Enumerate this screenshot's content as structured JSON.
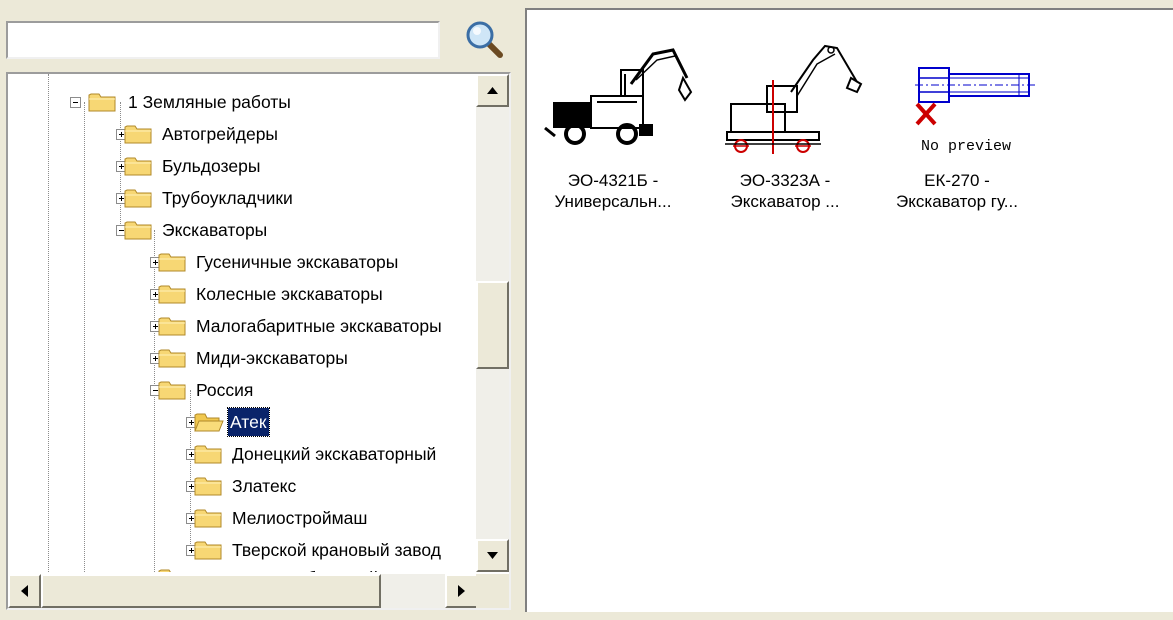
{
  "search": {
    "value": "",
    "placeholder": ""
  },
  "tree": {
    "items": [
      {
        "label": "1 Земляные работы",
        "state": "expanded"
      },
      {
        "label": "Автогрейдеры",
        "state": "collapsed"
      },
      {
        "label": "Бульдозеры",
        "state": "collapsed"
      },
      {
        "label": "Трубоукладчики",
        "state": "collapsed"
      },
      {
        "label": "Экскаваторы",
        "state": "expanded"
      },
      {
        "label": "Гусеничные экскаваторы",
        "state": "collapsed"
      },
      {
        "label": "Колесные экскаваторы",
        "state": "collapsed"
      },
      {
        "label": "Малогабаритные экскаваторы",
        "state": "collapsed"
      },
      {
        "label": "Миди-экскаваторы",
        "state": "collapsed"
      },
      {
        "label": "Россия",
        "state": "expanded"
      },
      {
        "label": "Атек",
        "state": "collapsed",
        "selected": true
      },
      {
        "label": "Донецкий экскаваторный",
        "state": "collapsed"
      },
      {
        "label": "Златекс",
        "state": "collapsed"
      },
      {
        "label": "Мелиостроймаш",
        "state": "collapsed"
      },
      {
        "label": "Тверской крановый завод",
        "state": "collapsed"
      },
      {
        "label": "Экскаваторы большой мощности",
        "state": "collapsed"
      }
    ]
  },
  "items": [
    {
      "line1": "ЭО-4321Б -",
      "line2": "Универсальн...",
      "icon": "wheeled-excavator-icon"
    },
    {
      "line1": "ЭО-3323А -",
      "line2": "Экскаватор ...",
      "icon": "excavator-drawing-icon"
    },
    {
      "line1": "ЕК-270 -",
      "line2": "Экскаватор гу...",
      "icon": "no-preview-icon",
      "preview_text": "No preview"
    }
  ],
  "colors": {
    "selection": "#0a246a",
    "window": "#ece9d8",
    "accent_red": "#cc0000",
    "accent_blue": "#0000cc"
  }
}
